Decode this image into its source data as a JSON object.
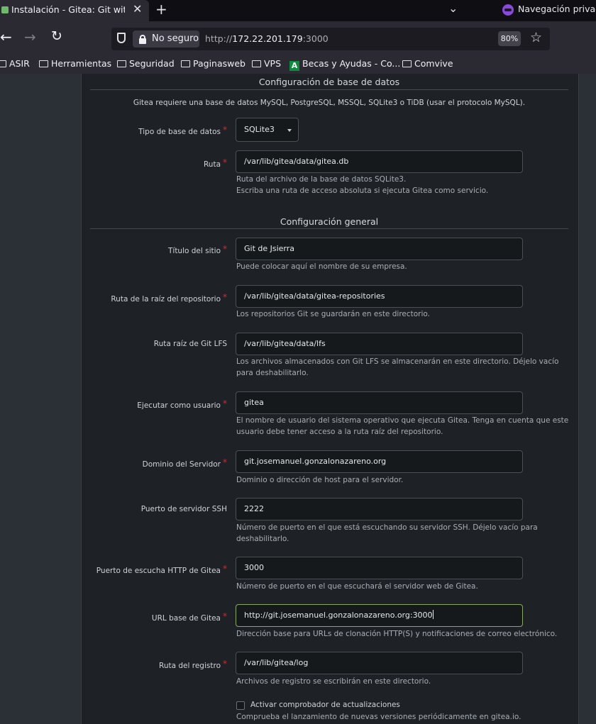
{
  "browser": {
    "tab_title": "Instalación - Gitea: Git with a cup of tea",
    "private_label": "Navegación privada",
    "security_label": "No seguro",
    "url_prefix": "http://",
    "url_host": "172.22.201.179",
    "url_port": ":3000",
    "zoom": "80%",
    "bookmarks": [
      "ASIR",
      "Herramientas",
      "Seguridad",
      "Paginasweb",
      "VPS",
      "Becas y Ayudas - Co...",
      "Comvive"
    ]
  },
  "db": {
    "section_title": "Configuración de base de datos",
    "intro": "Gitea requiere una base de datos MySQL, PostgreSQL, MSSQL, SQLite3 o TiDB (usar el protocolo MySQL).",
    "type_label": "Tipo de base de datos",
    "type_value": "SQLite3",
    "path_label": "Ruta",
    "path_value": "/var/lib/gitea/data/gitea.db",
    "path_help_1": "Ruta del archivo de la base de datos SQLite3.",
    "path_help_2": "Escriba una ruta de acceso absoluta si ejecuta Gitea como servicio."
  },
  "general": {
    "section_title": "Configuración general",
    "site_title_label": "Título del sitio",
    "site_title_value": "Git de Jsierra",
    "site_title_help": "Puede colocar aquí el nombre de su empresa.",
    "repo_root_label": "Ruta de la raíz del repositorio",
    "repo_root_value": "/var/lib/gitea/data/gitea-repositories",
    "repo_root_help": "Los repositorios Git se guardarán en este directorio.",
    "lfs_label": "Ruta raíz de Git LFS",
    "lfs_value": "/var/lib/gitea/data/lfs",
    "lfs_help_1": "Los archivos almacenados con Git LFS se almacenarán en este directorio. Déjelo vacío",
    "lfs_help_2": "para deshabilitarlo.",
    "run_user_label": "Ejecutar como usuario",
    "run_user_value": "gitea",
    "run_user_help_1": "El nombre de usuario del sistema operativo que ejecuta Gitea. Tenga en cuenta que este",
    "run_user_help_2": "usuario debe tener acceso a la ruta raíz del repositorio.",
    "domain_label": "Dominio del Servidor",
    "domain_value": "git.josemanuel.gonzalonazareno.org",
    "domain_help": "Dominio o dirección de host para el servidor.",
    "ssh_port_label": "Puerto de servidor SSH",
    "ssh_port_value": "2222",
    "ssh_port_help_1": "Número de puerto en el que está escuchando su servidor SSH. Déjelo vacío para",
    "ssh_port_help_2": "deshabilitarlo.",
    "http_port_label": "Puerto de escucha HTTP de Gitea",
    "http_port_value": "3000",
    "http_port_help": "Número de puerto en el que escuchará el servidor web de Gitea.",
    "base_url_label": "URL base de Gitea",
    "base_url_value": "http://git.josemanuel.gonzalonazareno.org:3000",
    "base_url_help": "Dirección base para URLs de clonación HTTP(S) y notificaciones de correo electrónico.",
    "log_path_label": "Ruta del registro",
    "log_path_value": "/var/lib/gitea/log",
    "log_path_help": "Archivos de registro se escribirán en este directorio.",
    "update_check_label": "Activar comprobador de actualizaciones",
    "update_check_help": "Comprueba el lanzamiento de nuevas versiones periódicamente en gitea.io."
  }
}
